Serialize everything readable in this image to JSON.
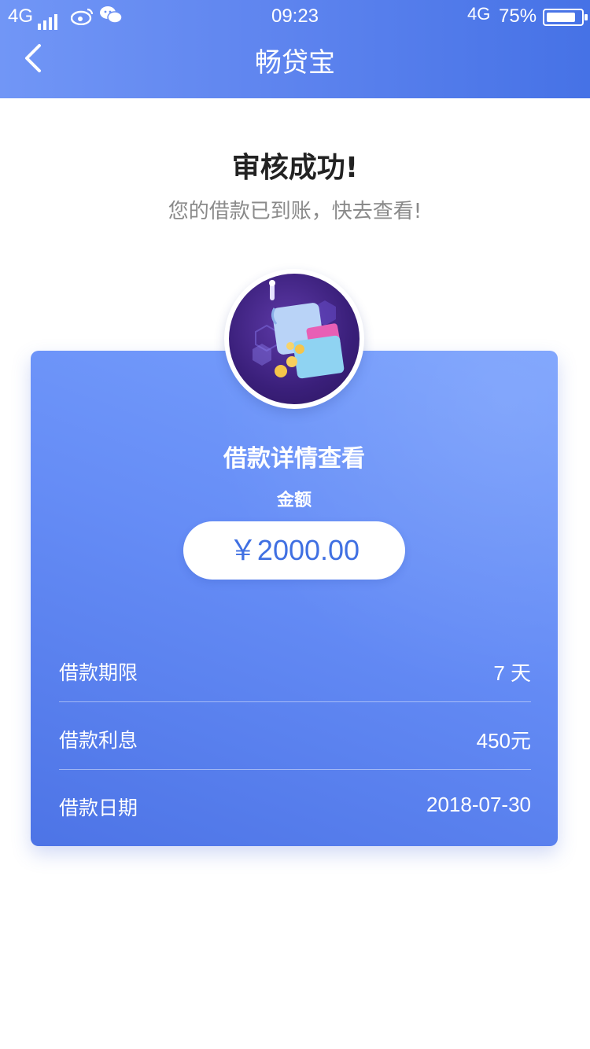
{
  "status_bar": {
    "network_left": "4G",
    "time": "09:23",
    "network_right": "4G",
    "battery_text": "75%",
    "battery_level": 0.75,
    "icons": [
      "signal-icon",
      "weibo-icon",
      "wechat-icon",
      "battery-icon"
    ]
  },
  "nav": {
    "title": "畅贷宝",
    "back_icon": "chevron-left-icon"
  },
  "result": {
    "headline": "审核成功!",
    "subline": "您的借款已到账，快去查看!"
  },
  "card": {
    "illustration": "wallet-with-coins-illustration",
    "title": "借款详情查看",
    "amount_label": "金额",
    "amount": "￥2000.00",
    "rows": [
      {
        "label": "借款期限",
        "value": "7 天"
      },
      {
        "label": "借款利息",
        "value": "450元"
      },
      {
        "label": "借款日期",
        "value": "2018-07-30"
      }
    ]
  },
  "colors": {
    "header_gradient_start": "#7196f6",
    "header_gradient_end": "#4672e6",
    "card_gradient_start": "#78a0fd",
    "card_gradient_end": "#4d74e6",
    "amount_text": "#4070e2",
    "headline_text": "#222222",
    "subline_text": "#8a8a8a"
  }
}
